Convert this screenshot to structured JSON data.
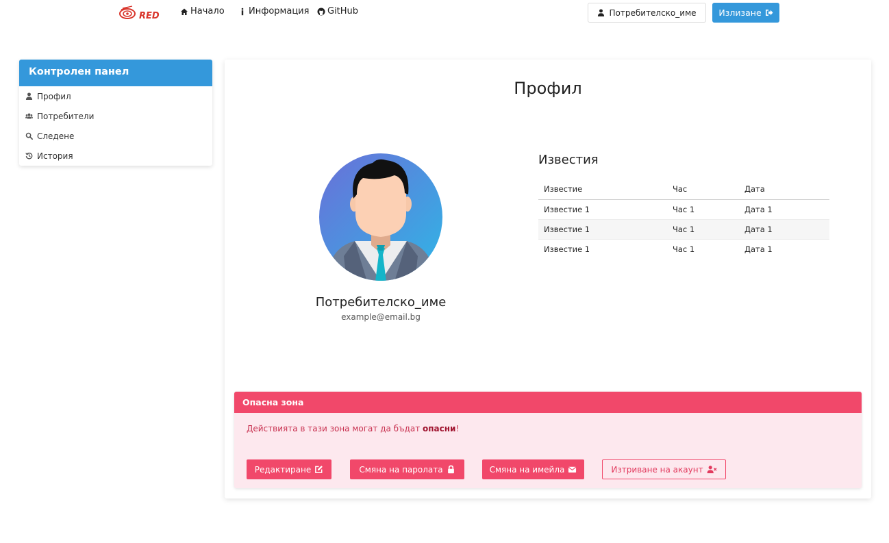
{
  "navbar": {
    "logo_text": "RED",
    "links": [
      {
        "label": "Начало",
        "icon": "home-icon"
      },
      {
        "label": "Информация",
        "icon": "info-icon"
      },
      {
        "label": "GitHub",
        "icon": "github-icon"
      }
    ],
    "user_button": "Потребителско_име",
    "logout_button": "Излизане"
  },
  "sidebar": {
    "title": "Контролен панел",
    "items": [
      {
        "label": "Профил",
        "icon": "user-icon"
      },
      {
        "label": "Потребители",
        "icon": "users-icon"
      },
      {
        "label": "Следене",
        "icon": "search-icon"
      },
      {
        "label": "История",
        "icon": "history-icon"
      }
    ]
  },
  "profile": {
    "page_title": "Профил",
    "username": "Потребителско_име",
    "email": "example@email.bg"
  },
  "news": {
    "title": "Известия",
    "headers": [
      "Известие",
      "Час",
      "Дата"
    ],
    "rows": [
      [
        "Известие 1",
        "Час 1",
        "Дата 1"
      ],
      [
        "Известие 1",
        "Час 1",
        "Дата 1"
      ],
      [
        "Известие 1",
        "Час 1",
        "Дата 1"
      ]
    ]
  },
  "danger_zone": {
    "title": "Опасна зона",
    "text_prefix": "Действията в тази зона могат да бъдат ",
    "text_bold": "опасни",
    "text_suffix": "!",
    "buttons": {
      "edit": "Редактиране",
      "change_password": "Смяна на паролата",
      "change_email": "Смяна на имейла",
      "delete_account": "Изтриване на акаунт"
    }
  },
  "colors": {
    "primary": "#3498db",
    "danger": "#f1486a",
    "danger_bg": "#fde8ee"
  }
}
